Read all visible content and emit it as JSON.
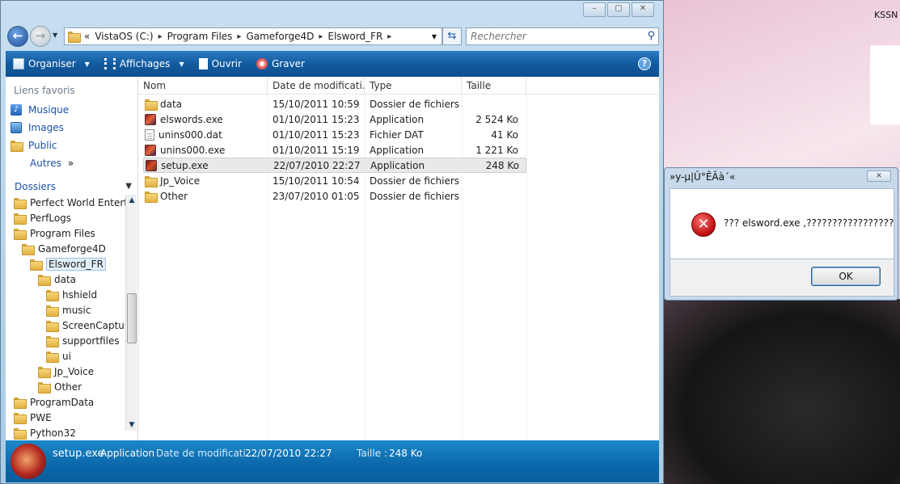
{
  "desktop": {
    "corner_label": "KSSN"
  },
  "address": {
    "back": "←",
    "forward": "→",
    "prefix": "«",
    "segments": [
      "VistaOS (C:)",
      "Program Files",
      "Gameforge4D",
      "Elsword_FR"
    ],
    "search_placeholder": "Rechercher"
  },
  "toolbar": {
    "organiser": "Organiser",
    "affichages": "Affichages",
    "ouvrir": "Ouvrir",
    "graver": "Graver",
    "help": "?"
  },
  "favorites": {
    "header": "Liens favoris",
    "items": [
      "Musique",
      "Images",
      "Public"
    ],
    "more": "Autres",
    "more_glyph": "»"
  },
  "folders": {
    "header": "Dossiers",
    "tree": [
      {
        "label": "Perfect World Enterta"
      },
      {
        "label": "PerfLogs"
      },
      {
        "label": "Program Files"
      },
      {
        "label": "Gameforge4D"
      },
      {
        "label": "Elsword_FR"
      },
      {
        "label": "data"
      },
      {
        "label": "hshield"
      },
      {
        "label": "music"
      },
      {
        "label": "ScreenCaptur"
      },
      {
        "label": "supportfiles"
      },
      {
        "label": "ui"
      },
      {
        "label": "Jp_Voice"
      },
      {
        "label": "Other"
      },
      {
        "label": "ProgramData"
      },
      {
        "label": "PWE"
      },
      {
        "label": "Python32"
      }
    ]
  },
  "columns": [
    "Nom",
    "Date de modificati...",
    "Type",
    "Taille"
  ],
  "files": [
    {
      "name": "data",
      "date": "15/10/2011 10:59",
      "type": "Dossier de fichiers",
      "size": "",
      "icon": "folder-icon"
    },
    {
      "name": "elswords.exe",
      "date": "01/10/2011 15:23",
      "type": "Application",
      "size": "2 524 Ko",
      "icon": "app-icon"
    },
    {
      "name": "unins000.dat",
      "date": "01/10/2011 15:23",
      "type": "Fichier DAT",
      "size": "41 Ko",
      "icon": "file-icon"
    },
    {
      "name": "unins000.exe",
      "date": "01/10/2011 15:19",
      "type": "Application",
      "size": "1 221 Ko",
      "icon": "app-icon"
    },
    {
      "name": "setup.exe",
      "date": "22/07/2010 22:27",
      "type": "Application",
      "size": "248 Ko",
      "icon": "app-icon"
    },
    {
      "name": "Jp_Voice",
      "date": "15/10/2011 10:54",
      "type": "Dossier de fichiers",
      "size": "",
      "icon": "folder-icon"
    },
    {
      "name": "Other",
      "date": "23/07/2010 01:05",
      "type": "Dossier de fichiers",
      "size": "",
      "icon": "folder-icon"
    }
  ],
  "details": {
    "name": "setup.exe",
    "type": "Application",
    "date_label": "Date de modificati...",
    "date": "22/07/2010 22:27",
    "size_label": "Taille :",
    "size": "248 Ko"
  },
  "dialog": {
    "title": "»y-µ|Û°ÊÂà´«",
    "message": "??? elsword.exe ,?????????????????",
    "ok": "OK",
    "error_glyph": "✕"
  },
  "colors": {
    "accent": "#125ba0",
    "details_bar": "#0b67aa",
    "error": "#c11212"
  }
}
